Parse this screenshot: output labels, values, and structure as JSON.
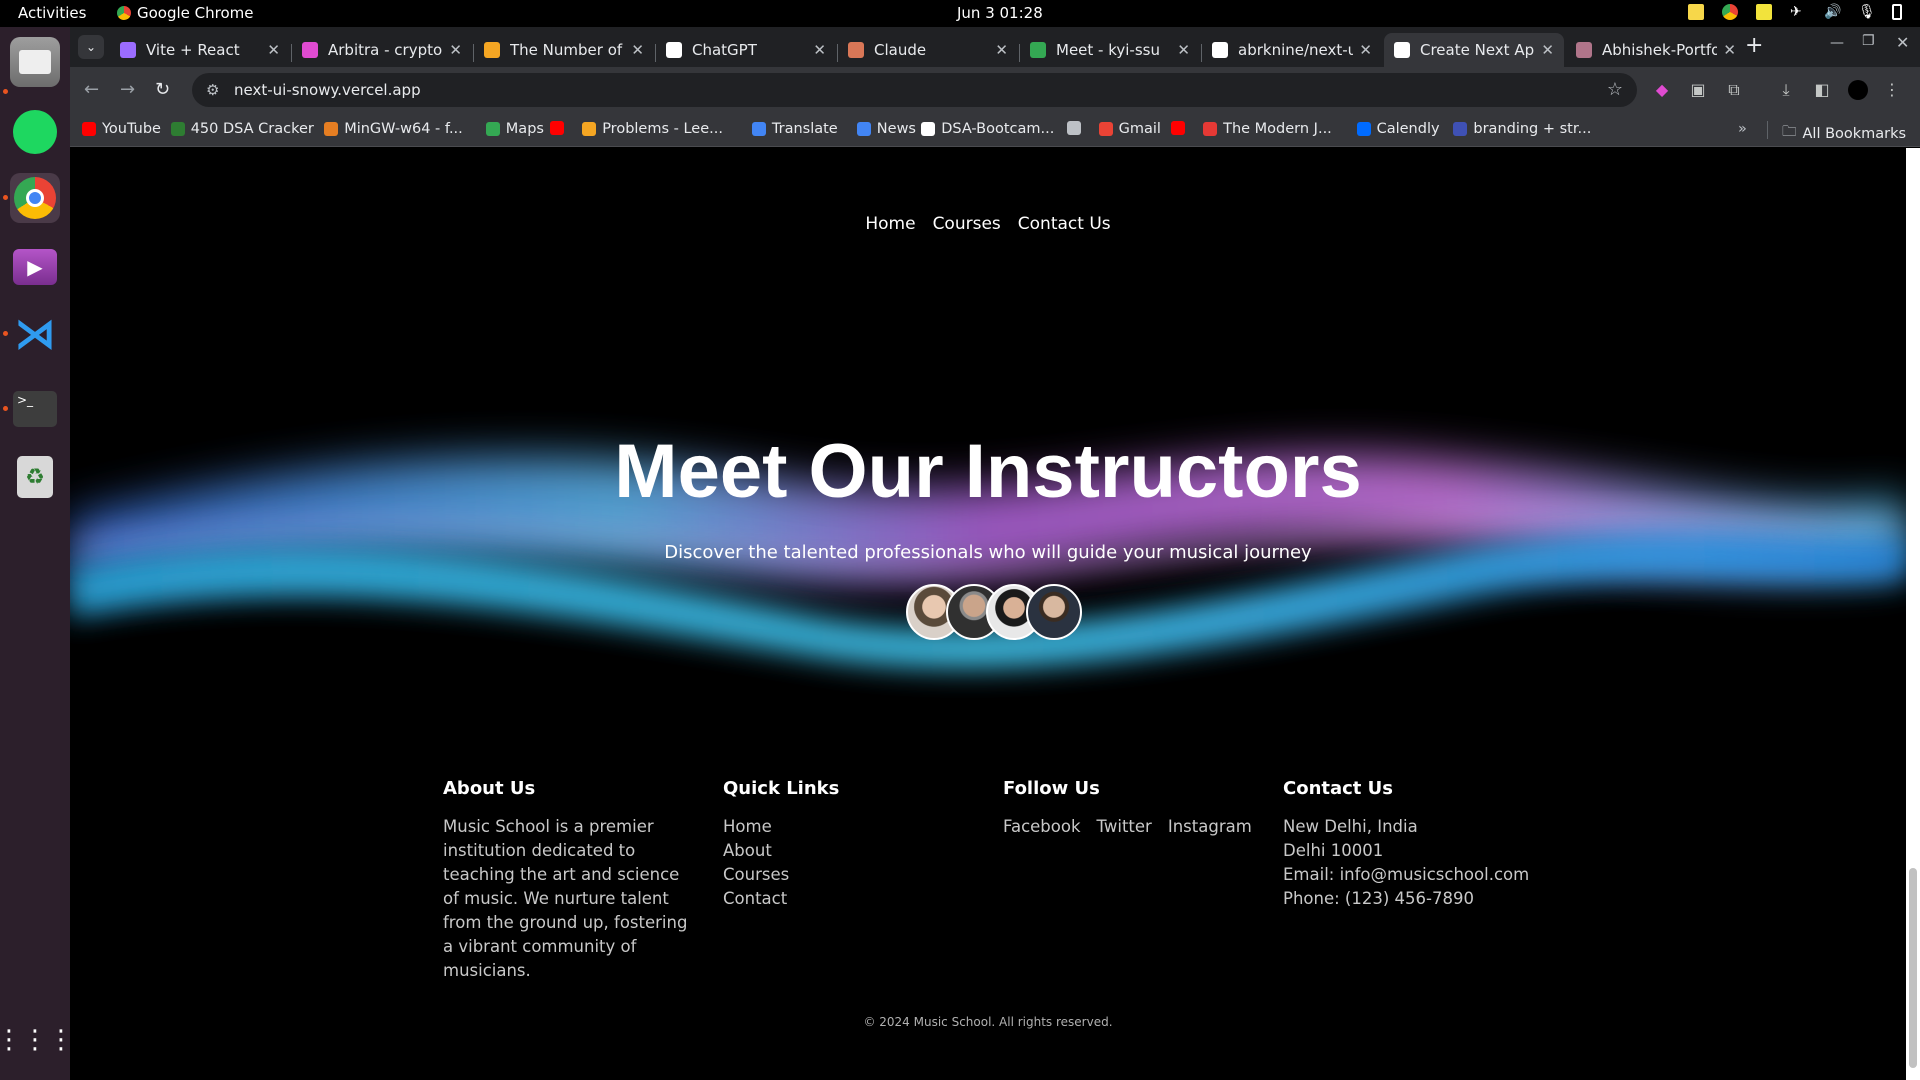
{
  "system": {
    "activities": "Activities",
    "app_name": "Google Chrome",
    "clock": "Jun 3  01:28"
  },
  "tabs": [
    {
      "title": "Vite + React",
      "color": "#9b6cff"
    },
    {
      "title": "Arbitra - crypto",
      "color": "#e04bd1"
    },
    {
      "title": "The Number of",
      "color": "#f5a623"
    },
    {
      "title": "ChatGPT",
      "color": "#ffffff"
    },
    {
      "title": "Claude",
      "color": "#d97757"
    },
    {
      "title": "Meet - kyi-ssu",
      "color": "#34a853"
    },
    {
      "title": "abrknine/next-u",
      "color": "#ffffff"
    },
    {
      "title": "Create Next App",
      "color": "#ffffff"
    },
    {
      "title": "Abhishek-Portfo",
      "color": "#b0758a"
    }
  ],
  "active_tab_index": 7,
  "toolbar": {
    "url": "next-ui-snowy.vercel.app"
  },
  "bookmarks": [
    {
      "label": "YouTube",
      "color": "#ff0000"
    },
    {
      "label": "450 DSA Cracker",
      "color": "#2e7d32"
    },
    {
      "label": "MinGW-w64 - f...",
      "color": "#e67e22"
    },
    {
      "label": "Maps",
      "color": "#34a853"
    },
    {
      "label": "",
      "color": "#ff0000"
    },
    {
      "label": "Problems - Lee...",
      "color": "#f5a623"
    },
    {
      "label": "Translate",
      "color": "#4285f4"
    },
    {
      "label": "News",
      "color": "#4285f4"
    },
    {
      "label": "DSA-Bootcam...",
      "color": "#ffffff"
    },
    {
      "label": "",
      "color": "#bdc1c6"
    },
    {
      "label": "Gmail",
      "color": "#ea4335"
    },
    {
      "label": "",
      "color": "#ff0000"
    },
    {
      "label": "The Modern J...",
      "color": "#e53935"
    },
    {
      "label": "Calendly",
      "color": "#006bff"
    },
    {
      "label": "branding + str...",
      "color": "#3f51b5"
    }
  ],
  "all_bookmarks": "All Bookmarks",
  "site": {
    "nav": [
      "Home",
      "Courses",
      "Contact Us"
    ],
    "hero_title": "Meet Our Instructors",
    "hero_subtitle": "Discover the talented professionals who will guide your musical journey",
    "footer": {
      "about": {
        "heading": "About Us",
        "text": "Music School is a premier institution dedicated to teaching the art and science of music. We nurture talent from the ground up, fostering a vibrant community of musicians."
      },
      "quick_links": {
        "heading": "Quick Links",
        "items": [
          "Home",
          "About",
          "Courses",
          "Contact"
        ]
      },
      "follow": {
        "heading": "Follow Us",
        "items": [
          "Facebook",
          "Twitter",
          "Instagram"
        ]
      },
      "contact": {
        "heading": "Contact Us",
        "lines": [
          "New Delhi, India",
          "Delhi 10001",
          "Email: info@musicschool.com",
          "Phone: (123) 456-7890"
        ]
      },
      "copyright": "© 2024 Music School. All rights reserved."
    }
  }
}
